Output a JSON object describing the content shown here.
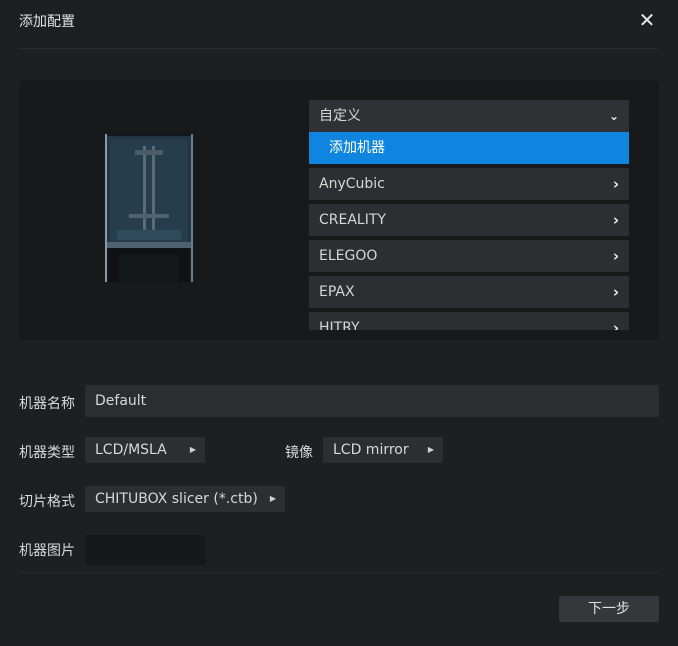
{
  "dialog": {
    "title": "添加配置",
    "close_icon": "close-icon"
  },
  "machine_list": {
    "header": "自定义",
    "header_icon": "chevron-down-icon",
    "selected": "添加机器",
    "items": [
      {
        "label": "AnyCubic",
        "icon": "chevron-right-icon"
      },
      {
        "label": "CREALITY",
        "icon": "chevron-right-icon"
      },
      {
        "label": "ELEGOO",
        "icon": "chevron-right-icon"
      },
      {
        "label": "EPAX",
        "icon": "chevron-right-icon"
      },
      {
        "label": "HITRY",
        "icon": "chevron-right-icon"
      }
    ]
  },
  "form": {
    "name_label": "机器名称",
    "name_value": "Default",
    "type_label": "机器类型",
    "type_value": "LCD/MSLA",
    "mirror_label": "镜像",
    "mirror_value": "LCD mirror",
    "slice_label": "切片格式",
    "slice_value": "CHITUBOX slicer (*.ctb)",
    "image_label": "机器图片"
  },
  "footer": {
    "next_label": "下一步"
  },
  "colors": {
    "accent": "#0f85e0",
    "background": "#1e1f21",
    "panel": "#17191a"
  }
}
